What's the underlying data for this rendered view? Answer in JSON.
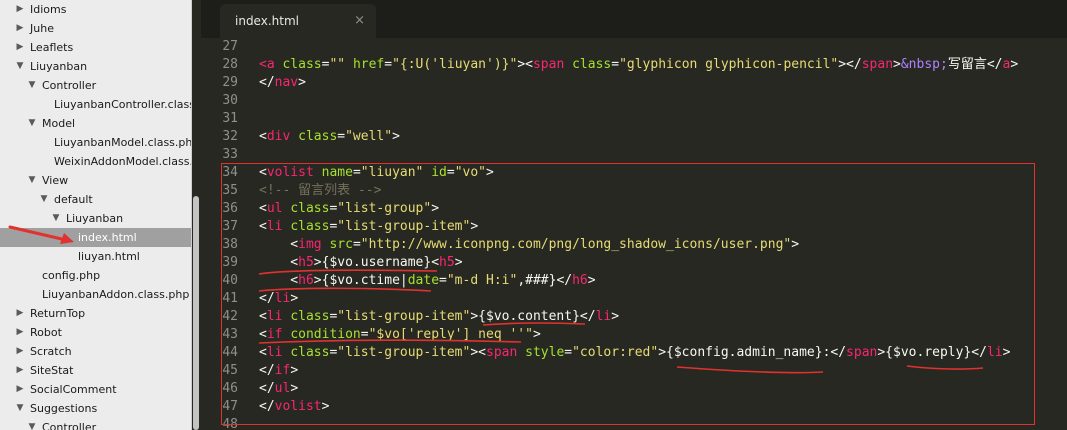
{
  "sidebar": {
    "items": [
      {
        "label": "Idioms",
        "expanded": false,
        "selected": false
      },
      {
        "label": "Juhe",
        "expanded": false,
        "selected": false
      },
      {
        "label": "Leaflets",
        "expanded": false,
        "selected": false
      },
      {
        "label": "Liuyanban",
        "expanded": true,
        "selected": false
      },
      {
        "label": "Controller",
        "expanded": true,
        "selected": false
      },
      {
        "label": "LiuyanbanController.class.p",
        "selected": false
      },
      {
        "label": "Model",
        "expanded": true,
        "selected": false
      },
      {
        "label": "LiuyanbanModel.class.php",
        "selected": false
      },
      {
        "label": "WeixinAddonModel.class.p",
        "selected": false
      },
      {
        "label": "View",
        "expanded": true,
        "selected": false
      },
      {
        "label": "default",
        "expanded": true,
        "selected": false
      },
      {
        "label": "Liuyanban",
        "expanded": true,
        "selected": false
      },
      {
        "label": "index.html",
        "selected": true
      },
      {
        "label": "liuyan.html",
        "selected": false
      },
      {
        "label": "config.php",
        "selected": false
      },
      {
        "label": "LiuyanbanAddon.class.php",
        "selected": false
      },
      {
        "label": "ReturnTop",
        "expanded": false,
        "selected": false
      },
      {
        "label": "Robot",
        "expanded": false,
        "selected": false
      },
      {
        "label": "Scratch",
        "expanded": false,
        "selected": false
      },
      {
        "label": "SiteStat",
        "expanded": false,
        "selected": false
      },
      {
        "label": "SocialComment",
        "expanded": false,
        "selected": false
      },
      {
        "label": "Suggestions",
        "expanded": true,
        "selected": false
      },
      {
        "label": "Controller",
        "expanded": true,
        "selected": false
      }
    ]
  },
  "tab": {
    "title": "index.html",
    "close_glyph": "×"
  },
  "editor": {
    "line_numbers": [
      "27",
      "28",
      "29",
      "30",
      "31",
      "32",
      "33",
      "34",
      "35",
      "36",
      "37",
      "38",
      "39",
      "40",
      "41",
      "42",
      "43",
      "44",
      "45",
      "46",
      "47",
      "48"
    ],
    "lines": [
      [],
      [
        {
          "t": "<",
          "c": "tg"
        },
        {
          "t": "a",
          "c": "tg"
        },
        {
          "t": " "
        },
        {
          "t": "class",
          "c": "at"
        },
        {
          "t": "="
        },
        {
          "t": "\"\"",
          "c": "st"
        },
        {
          "t": " "
        },
        {
          "t": "href",
          "c": "at"
        },
        {
          "t": "="
        },
        {
          "t": "\"{:U('liuyan')}\"",
          "c": "st"
        },
        {
          "t": "><"
        },
        {
          "t": "span",
          "c": "tg"
        },
        {
          "t": " "
        },
        {
          "t": "class",
          "c": "at"
        },
        {
          "t": "="
        },
        {
          "t": "\"glyphicon glyphicon-pencil\"",
          "c": "st"
        },
        {
          "t": "></"
        },
        {
          "t": "span",
          "c": "tg"
        },
        {
          "t": ">"
        },
        {
          "t": "&nbsp;",
          "c": "en"
        },
        {
          "t": "写留言</"
        },
        {
          "t": "a",
          "c": "tg"
        },
        {
          "t": ">"
        }
      ],
      [
        {
          "t": "</"
        },
        {
          "t": "nav",
          "c": "tg"
        },
        {
          "t": ">"
        }
      ],
      [],
      [],
      [
        {
          "t": "<"
        },
        {
          "t": "div",
          "c": "tg"
        },
        {
          "t": " "
        },
        {
          "t": "class",
          "c": "at"
        },
        {
          "t": "="
        },
        {
          "t": "\"well\"",
          "c": "st"
        },
        {
          "t": ">"
        }
      ],
      [],
      [
        {
          "t": "<"
        },
        {
          "t": "volist",
          "c": "tg"
        },
        {
          "t": " "
        },
        {
          "t": "name",
          "c": "at"
        },
        {
          "t": "="
        },
        {
          "t": "\"liuyan\"",
          "c": "st"
        },
        {
          "t": " "
        },
        {
          "t": "id",
          "c": "at"
        },
        {
          "t": "="
        },
        {
          "t": "\"vo\"",
          "c": "st"
        },
        {
          "t": ">"
        }
      ],
      [
        {
          "t": "<!-- 留言列表 -->",
          "c": "cm"
        }
      ],
      [
        {
          "t": "<"
        },
        {
          "t": "ul",
          "c": "tg"
        },
        {
          "t": " "
        },
        {
          "t": "class",
          "c": "at"
        },
        {
          "t": "="
        },
        {
          "t": "\"list-group\"",
          "c": "st"
        },
        {
          "t": ">"
        }
      ],
      [
        {
          "t": "<"
        },
        {
          "t": "li",
          "c": "tg"
        },
        {
          "t": " "
        },
        {
          "t": "class",
          "c": "at"
        },
        {
          "t": "="
        },
        {
          "t": "\"list-group-item\"",
          "c": "st"
        },
        {
          "t": ">"
        }
      ],
      [
        {
          "t": "    <"
        },
        {
          "t": "img",
          "c": "tg"
        },
        {
          "t": " "
        },
        {
          "t": "src",
          "c": "at"
        },
        {
          "t": "="
        },
        {
          "t": "\"http://www.iconpng.com/png/long_shadow_icons/user.png\"",
          "c": "st"
        },
        {
          "t": ">"
        }
      ],
      [
        {
          "t": "    <"
        },
        {
          "t": "h5",
          "c": "tg"
        },
        {
          "t": ">{$vo.username}<"
        },
        {
          "t": "h5",
          "c": "tg"
        },
        {
          "t": ">"
        }
      ],
      [
        {
          "t": "    <"
        },
        {
          "t": "h6",
          "c": "tg"
        },
        {
          "t": ">{$vo.ctime|"
        },
        {
          "t": "date",
          "c": "at"
        },
        {
          "t": "="
        },
        {
          "t": "\"m-d H:i\"",
          "c": "st"
        },
        {
          "t": ",###}</"
        },
        {
          "t": "h6",
          "c": "tg"
        },
        {
          "t": ">"
        }
      ],
      [
        {
          "t": "</"
        },
        {
          "t": "li",
          "c": "tg"
        },
        {
          "t": ">"
        }
      ],
      [
        {
          "t": "<"
        },
        {
          "t": "li",
          "c": "tg"
        },
        {
          "t": " "
        },
        {
          "t": "class",
          "c": "at"
        },
        {
          "t": "="
        },
        {
          "t": "\"list-group-item\"",
          "c": "st"
        },
        {
          "t": ">{$vo.content}</"
        },
        {
          "t": "li",
          "c": "tg"
        },
        {
          "t": ">"
        }
      ],
      [
        {
          "t": "<"
        },
        {
          "t": "if",
          "c": "tg"
        },
        {
          "t": " "
        },
        {
          "t": "condition",
          "c": "at"
        },
        {
          "t": "="
        },
        {
          "t": "\"$vo['reply'] neq ''\"",
          "c": "st"
        },
        {
          "t": ">"
        }
      ],
      [
        {
          "t": "<"
        },
        {
          "t": "li",
          "c": "tg"
        },
        {
          "t": " "
        },
        {
          "t": "class",
          "c": "at"
        },
        {
          "t": "="
        },
        {
          "t": "\"list-group-item\"",
          "c": "st"
        },
        {
          "t": "><"
        },
        {
          "t": "span",
          "c": "tg"
        },
        {
          "t": " "
        },
        {
          "t": "style",
          "c": "at"
        },
        {
          "t": "="
        },
        {
          "t": "\"color:red\"",
          "c": "st"
        },
        {
          "t": ">{$config.admin_name}:</"
        },
        {
          "t": "span",
          "c": "tg"
        },
        {
          "t": ">{$vo.reply}</"
        },
        {
          "t": "li",
          "c": "tg"
        },
        {
          "t": ">"
        }
      ],
      [
        {
          "t": "</"
        },
        {
          "t": "if",
          "c": "tg"
        },
        {
          "t": ">"
        }
      ],
      [
        {
          "t": "</"
        },
        {
          "t": "ul",
          "c": "tg"
        },
        {
          "t": ">"
        }
      ],
      [
        {
          "t": "</"
        },
        {
          "t": "volist",
          "c": "tg"
        },
        {
          "t": ">"
        }
      ],
      []
    ]
  },
  "colors": {
    "editor_bg": "#272822",
    "tag": "#f92672",
    "attribute": "#a6e22e",
    "string": "#e6db74",
    "comment": "#75715e",
    "entity": "#ae81ff",
    "annotation": "#e0322e",
    "sidebar_bg": "#ececec",
    "sidebar_selected": "#a0a0a0"
  }
}
